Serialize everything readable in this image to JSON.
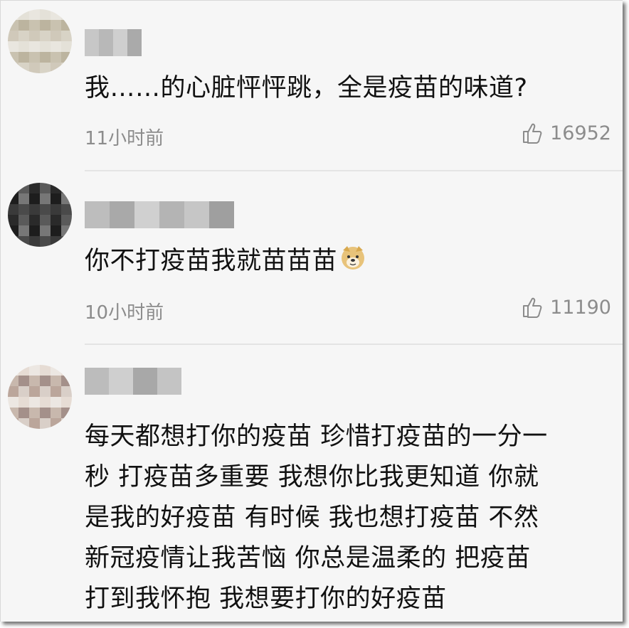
{
  "comments": [
    {
      "text": "我……的心脏怦怦跳，全是疫苗的味道?",
      "time": "11小时前",
      "likes": "16952",
      "avatar_colors": [
        "#e9e6df",
        "#d8d3c6",
        "#c9c2b0",
        "#e4e1d8",
        "#d0c9ba",
        "#bcb49f"
      ],
      "username_colors": [
        "#c7c7c7",
        "#b8b8b8",
        "#cfcfcf",
        "#aaaaaa"
      ]
    },
    {
      "text": "你不打疫苗我就苗苗苗",
      "emoji": "doge-emoji",
      "time": "10小时前",
      "likes": "11190",
      "avatar_colors": [
        "#2a2a2a",
        "#4a4a4a",
        "#1d1d1d",
        "#5a5a5a",
        "#3a3a3a",
        "#777777"
      ],
      "username_colors": [
        "#bdbdbd",
        "#a9a9a9",
        "#d0d0d0",
        "#b4b4b4",
        "#c6c6c6",
        "#9f9f9f"
      ]
    },
    {
      "lines": [
        "每天都想打你的疫苗 珍惜打疫苗的一分一",
        "秒 打疫苗多重要 我想你比我更知道 你就",
        "是我的好疫苗 有时候 我也想打疫苗 不然",
        "新冠疫情让我苦恼 你总是温柔的 把疫苗",
        "打到我怀抱 我想要打你的好疫苗"
      ],
      "avatar_colors": [
        "#ece7e2",
        "#d9cfc8",
        "#c8b8ad",
        "#e6dcd4",
        "#bba69b",
        "#a4908a"
      ],
      "username_colors": [
        "#bcbcbc",
        "#cfcfcf",
        "#a8a8a8",
        "#c4c4c4"
      ]
    }
  ],
  "colors": {
    "background": "#f6f6f6",
    "text": "#111111",
    "meta": "#8c8c8c",
    "divider": "#e4e4e4"
  }
}
